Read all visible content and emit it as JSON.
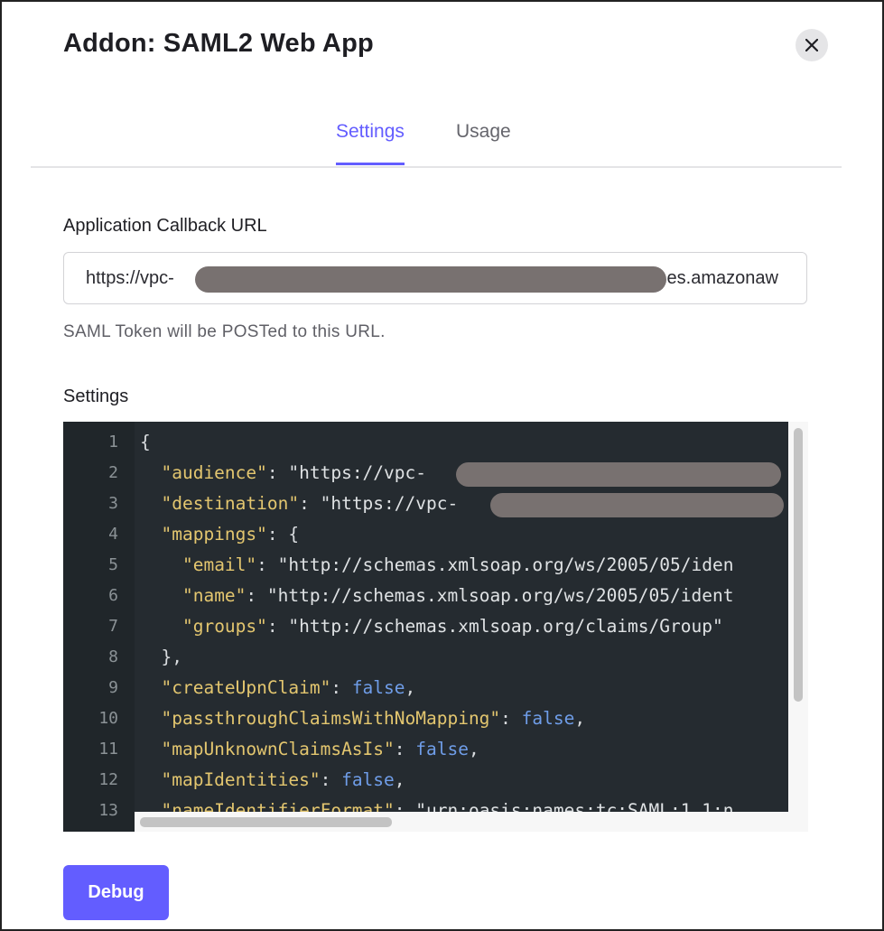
{
  "modal": {
    "title": "Addon: SAML2 Web App"
  },
  "tabs": [
    {
      "label": "Settings",
      "active": true
    },
    {
      "label": "Usage",
      "active": false
    }
  ],
  "callback": {
    "label": "Application Callback URL",
    "value_prefix": "https://vpc-",
    "value_suffix": ".es.amazonaw",
    "helper": "SAML Token will be POSTed to this URL."
  },
  "settings": {
    "label": "Settings",
    "line_numbers": [
      "1",
      "2",
      "3",
      "4",
      "5",
      "6",
      "7",
      "8",
      "9",
      "10",
      "11",
      "12",
      "13"
    ],
    "code": {
      "l1": "{",
      "l2_key": "\"audience\"",
      "l2_val": "\"https://vpc-",
      "l3_key": "\"destination\"",
      "l3_val": "\"https://vpc-",
      "l4_key": "\"mappings\"",
      "l4_rest": ": {",
      "l5_key": "\"email\"",
      "l5_val": "\"http://schemas.xmlsoap.org/ws/2005/05/iden",
      "l6_key": "\"name\"",
      "l6_val": "\"http://schemas.xmlsoap.org/ws/2005/05/ident",
      "l7_key": "\"groups\"",
      "l7_val": "\"http://schemas.xmlsoap.org/claims/Group\"",
      "l8": "},",
      "l9_key": "\"createUpnClaim\"",
      "l9_val": "false",
      "l10_key": "\"passthroughClaimsWithNoMapping\"",
      "l10_val": "false",
      "l11_key": "\"mapUnknownClaimsAsIs\"",
      "l11_val": "false",
      "l12_key": "\"mapIdentities\"",
      "l12_val": "false",
      "l13_key": "\"nameIdentifierFormat\"",
      "l13_val": "\"urn:oasis:names:tc:SAML:1.1:n"
    }
  },
  "debug_button": {
    "label": "Debug"
  },
  "colors": {
    "accent": "#635dff",
    "editor_bg": "#252b30",
    "json_key": "#e3c66f",
    "json_bool": "#6f9de8"
  },
  "icons": {
    "close": "close-icon"
  }
}
